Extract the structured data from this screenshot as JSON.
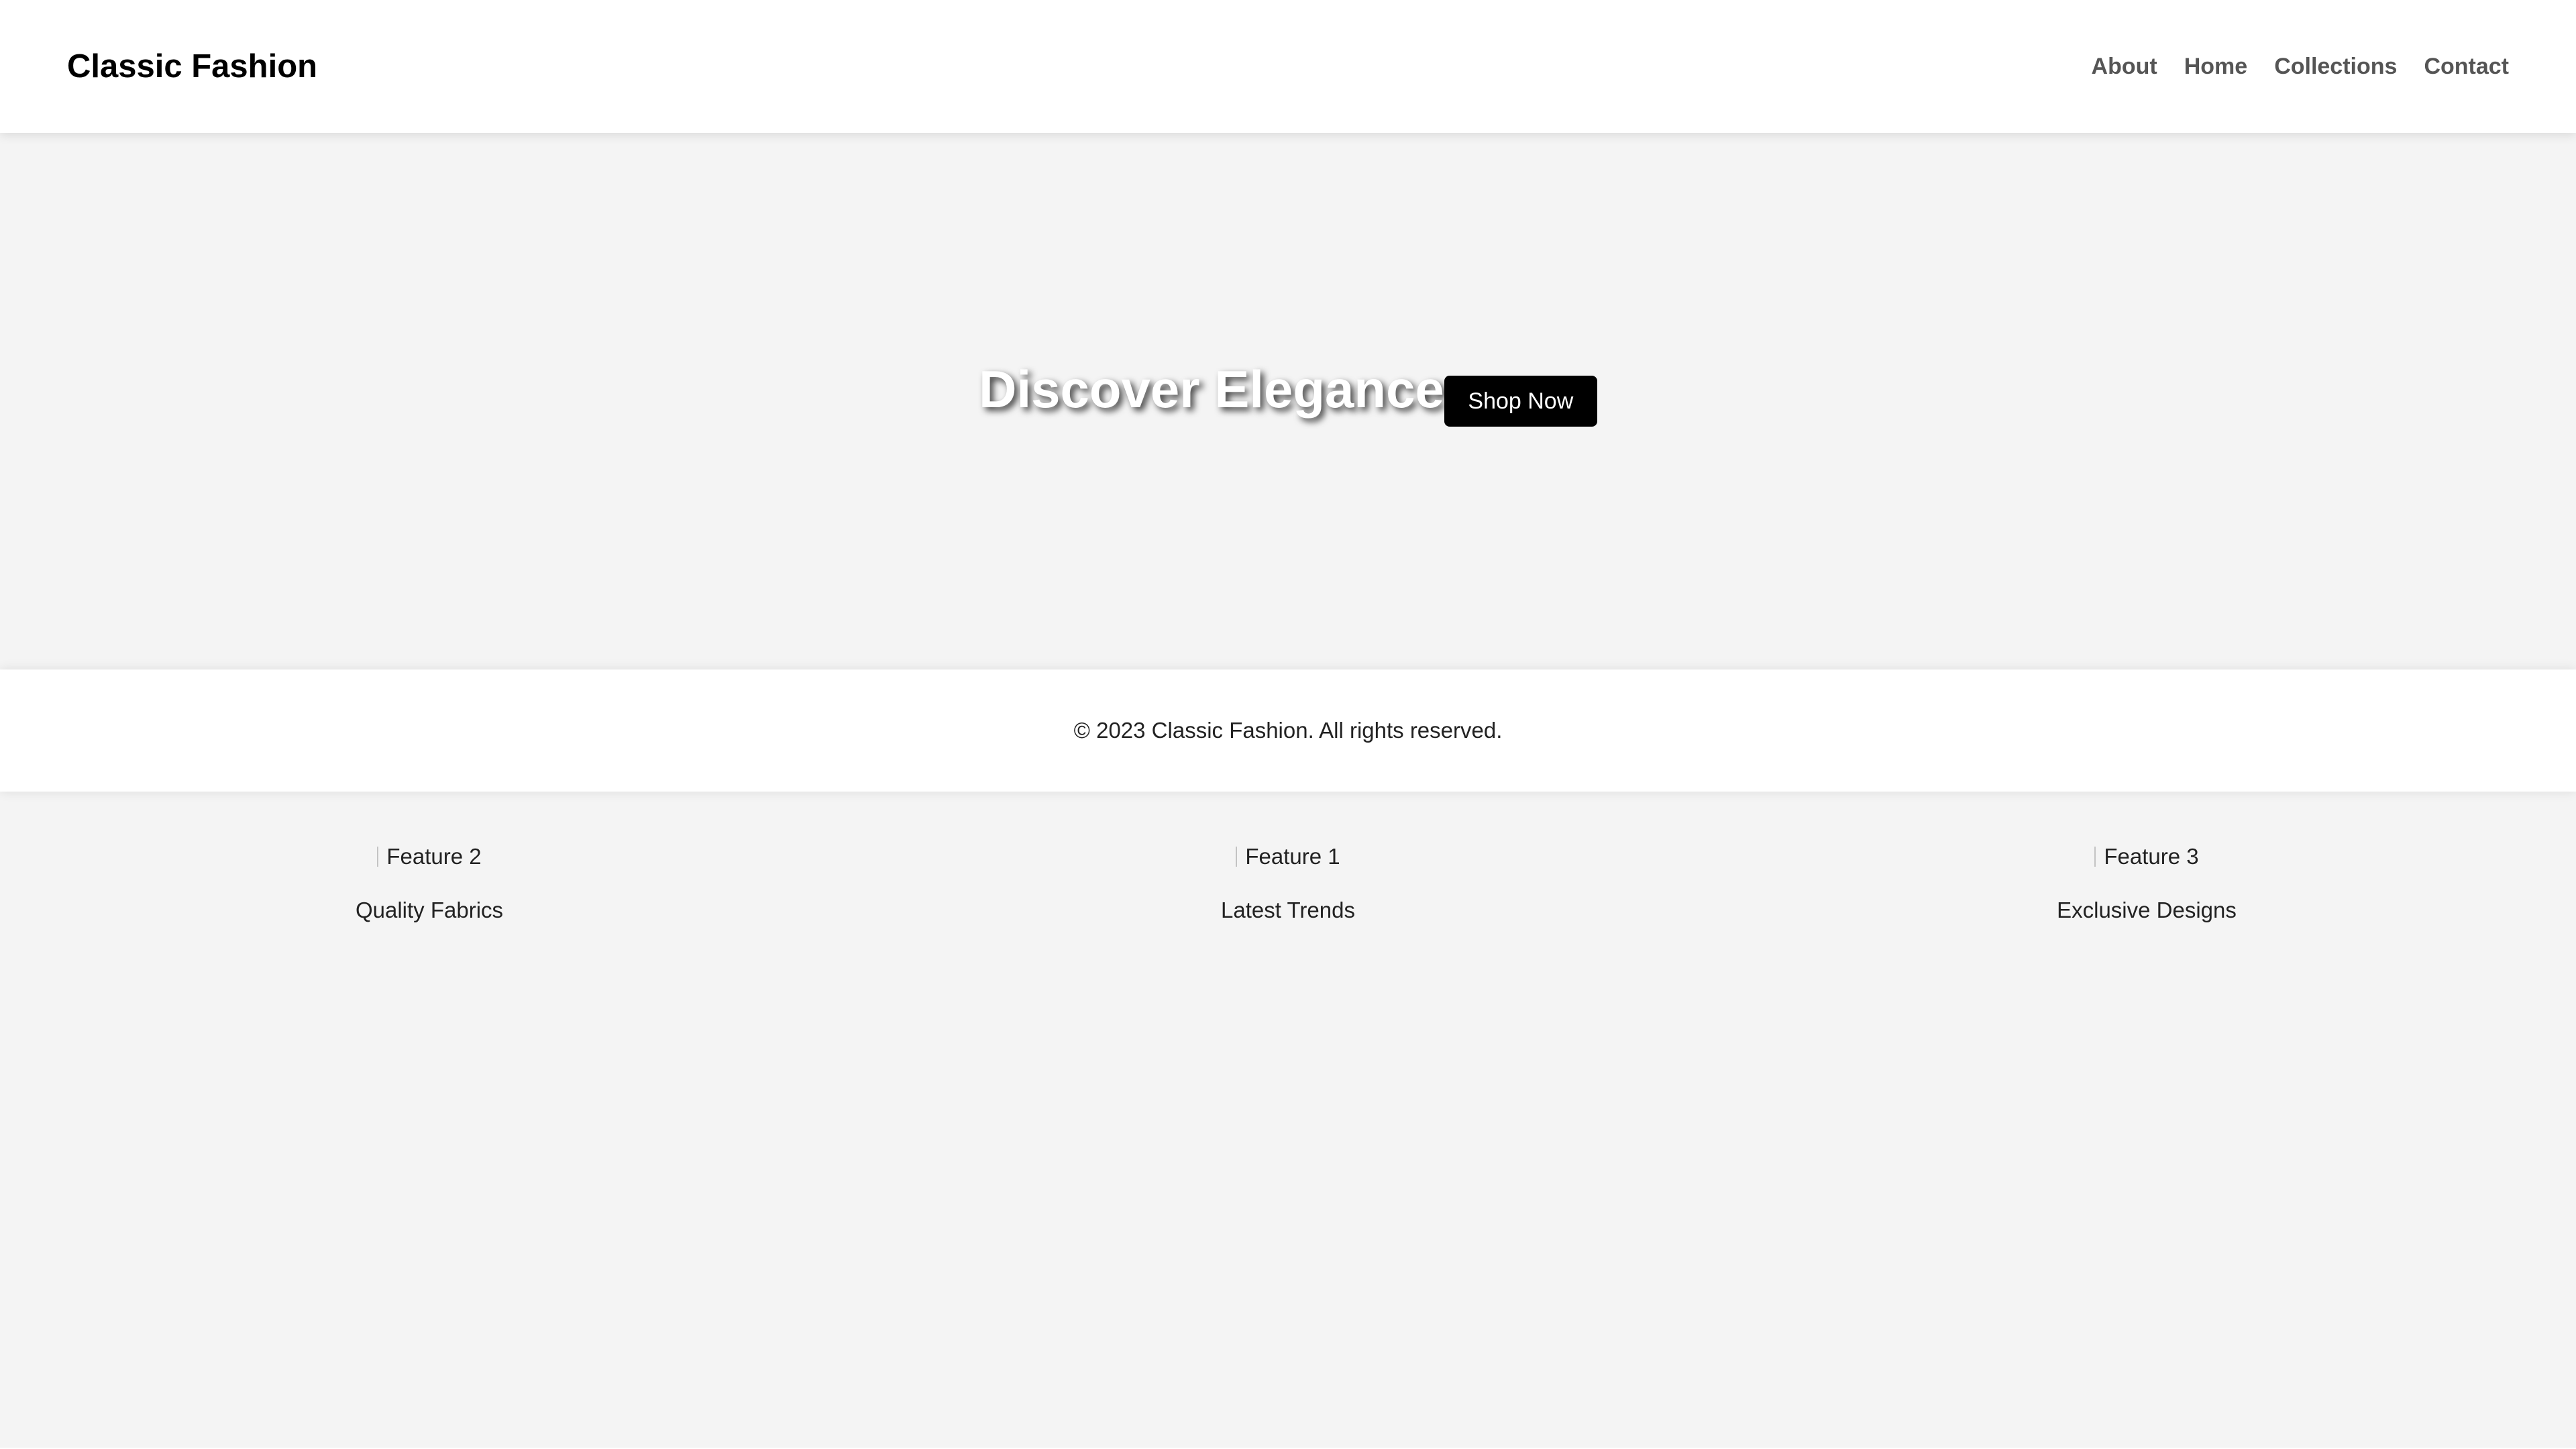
{
  "header": {
    "brand": "Classic Fashion",
    "nav": [
      {
        "label": "About"
      },
      {
        "label": "Home"
      },
      {
        "label": "Collections"
      },
      {
        "label": "Contact"
      }
    ]
  },
  "hero": {
    "title": "Discover Elegance",
    "button_label": "Shop Now"
  },
  "footer": {
    "copyright": "© 2023 Classic Fashion. All rights reserved."
  },
  "features": [
    {
      "image_alt": "Feature 2",
      "caption": "Quality Fabrics"
    },
    {
      "image_alt": "Feature 1",
      "caption": "Latest Trends"
    },
    {
      "image_alt": "Feature 3",
      "caption": "Exclusive Designs"
    }
  ],
  "colors": {
    "background": "#f4f4f4",
    "header_bg": "#ffffff",
    "button_bg": "#000000",
    "button_text": "#ffffff",
    "nav_text": "#555555"
  }
}
